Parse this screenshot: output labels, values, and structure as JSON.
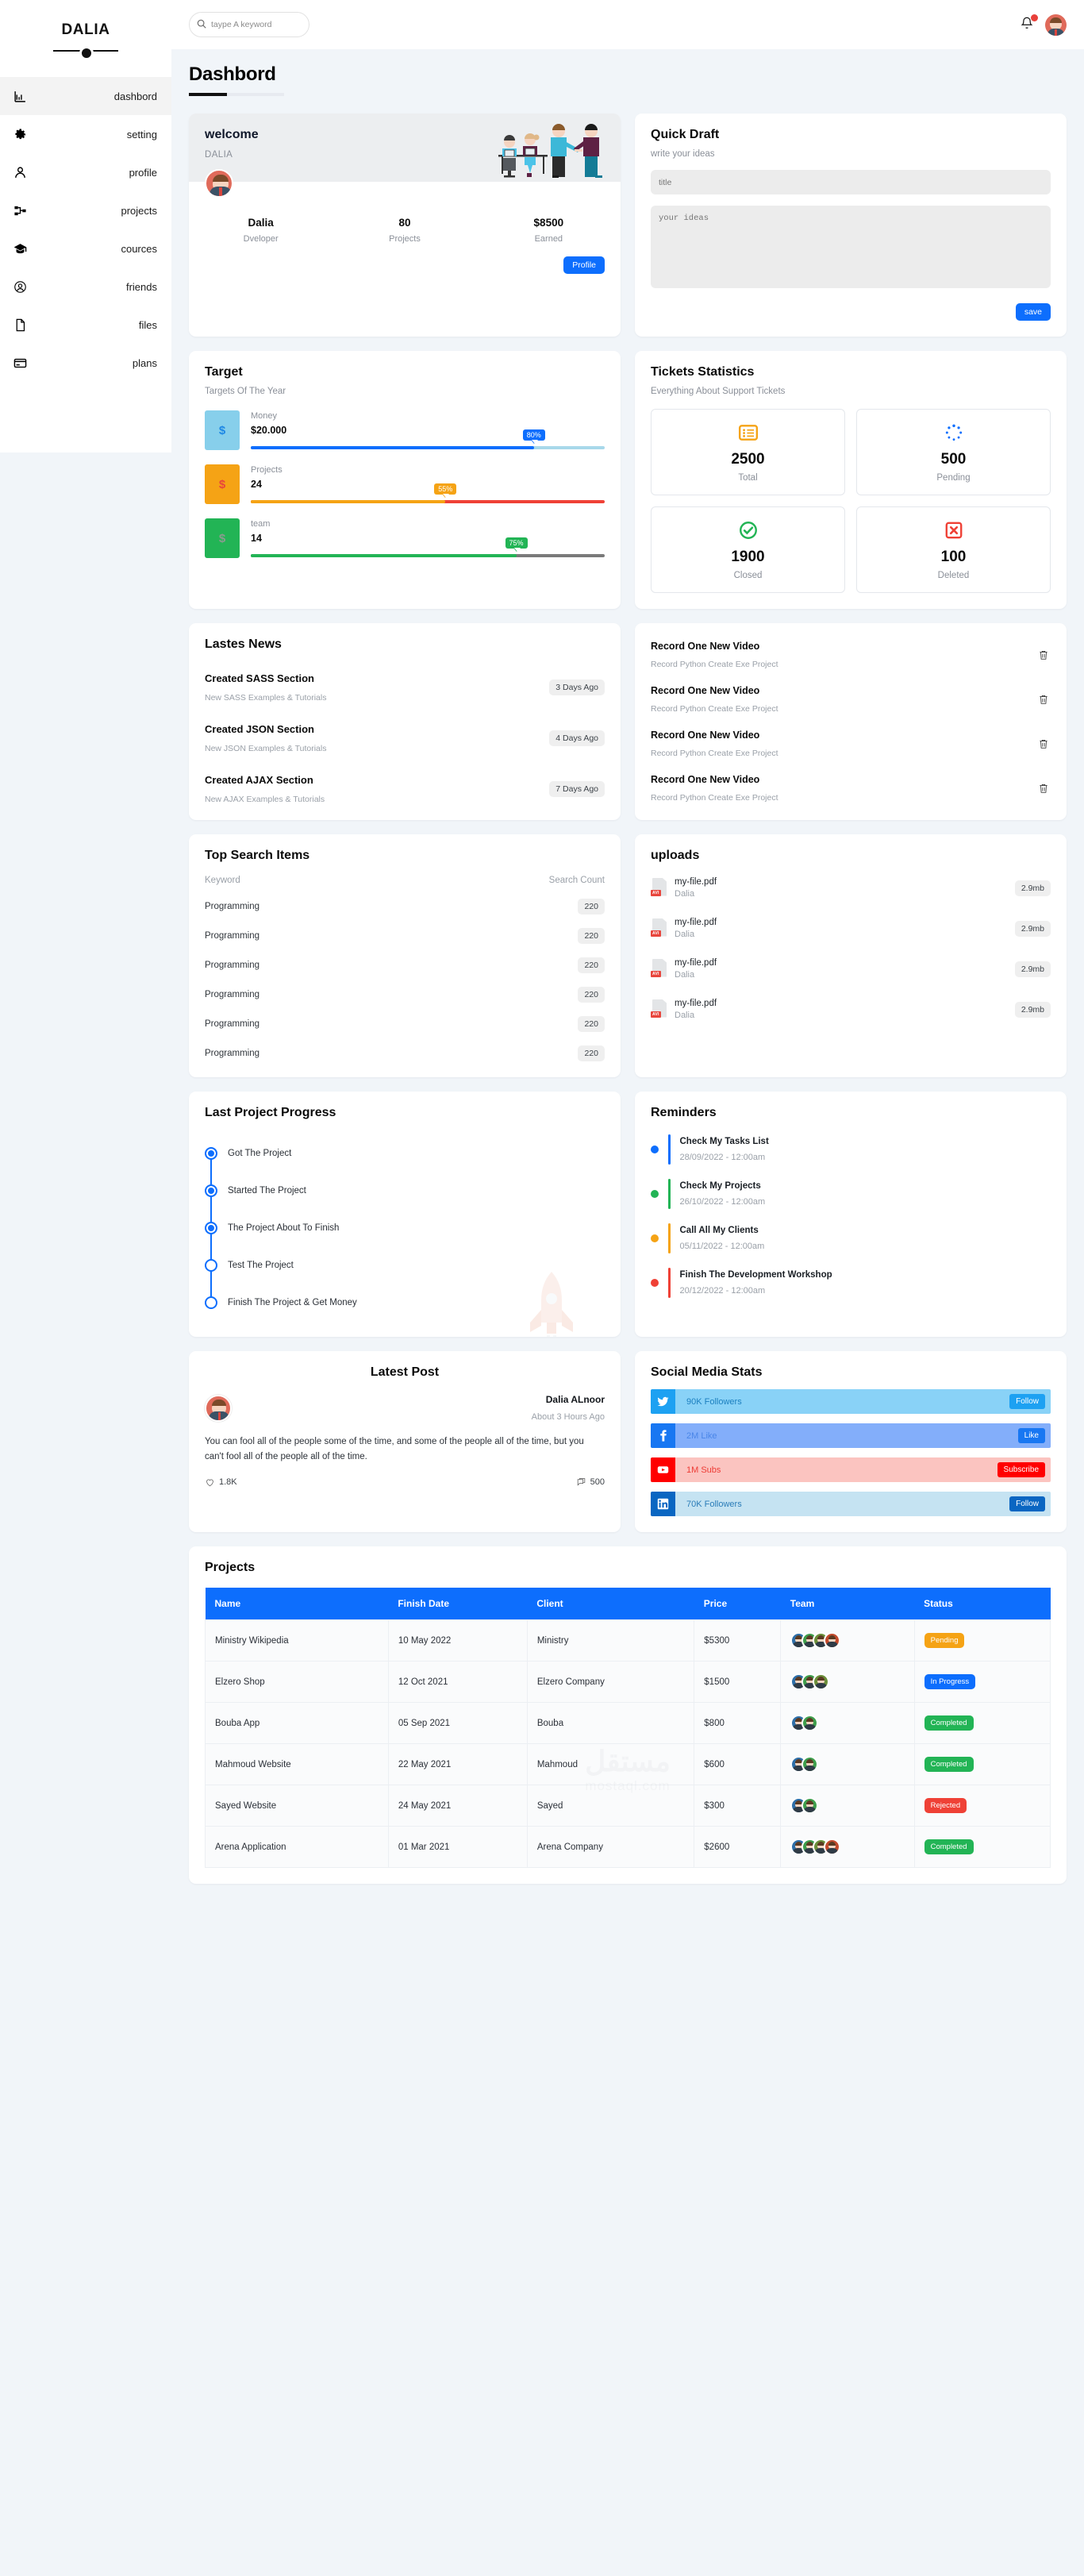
{
  "sidebar": {
    "brand": "DALIA",
    "items": [
      {
        "label": "dashbord",
        "icon": "chart-bar-icon",
        "active": true
      },
      {
        "label": "setting",
        "icon": "gear-icon",
        "active": false
      },
      {
        "label": "profile",
        "icon": "user-icon",
        "active": false
      },
      {
        "label": "projects",
        "icon": "sitemap-icon",
        "active": false
      },
      {
        "label": "cources",
        "icon": "graduation-cap-icon",
        "active": false
      },
      {
        "label": "friends",
        "icon": "user-circle-icon",
        "active": false
      },
      {
        "label": "files",
        "icon": "file-icon",
        "active": false
      },
      {
        "label": "plans",
        "icon": "credit-card-icon",
        "active": false
      }
    ]
  },
  "topbar": {
    "search_placeholder": "taype A keyword",
    "search_value": "",
    "notification_badge": true
  },
  "page": {
    "title": "Dashbord"
  },
  "welcome": {
    "heading": "welcome",
    "name": "DALIA",
    "stats": [
      {
        "value": "Dalia",
        "label": "Dveloper"
      },
      {
        "value": "80",
        "label": "Projects"
      },
      {
        "value": "$8500",
        "label": "Earned"
      }
    ],
    "button": "Profile"
  },
  "quick_draft": {
    "title": "Quick Draft",
    "subtitle": "write your ideas",
    "title_placeholder": "title",
    "title_value": "",
    "body_placeholder": "your ideas",
    "body_value": "",
    "save_label": "save"
  },
  "target": {
    "title": "Target",
    "subtitle": "Targets Of The Year",
    "rows": [
      {
        "label": "Money",
        "value": "$20.000",
        "percent": "80%",
        "pct": 80,
        "box_bg": "#87cfeb",
        "sym_color": "#1e88e5",
        "fill": "#0d6efd",
        "track": "#a8d8ea",
        "badge": "#0d6efd"
      },
      {
        "label": "Projects",
        "value": "24",
        "percent": "55%",
        "pct": 55,
        "box_bg": "#f5a315",
        "sym_color": "#e8453c",
        "fill": "#f5a315",
        "track": "#ef4136",
        "badge": "#f5a315"
      },
      {
        "label": "team",
        "value": "14",
        "percent": "75%",
        "pct": 75,
        "box_bg": "#22b455",
        "sym_color": "#8a9b8f",
        "fill": "#22b455",
        "track": "#7a7a7a",
        "badge": "#22b455"
      }
    ],
    "symbol": "$"
  },
  "tickets": {
    "title": "Tickets Statistics",
    "subtitle": "Everything About Support Tickets",
    "boxes": [
      {
        "number": "2500",
        "label": "Total",
        "icon": "list-icon",
        "color": "#f5a315"
      },
      {
        "number": "500",
        "label": "Pending",
        "icon": "spinner-icon",
        "color": "#0d6efd"
      },
      {
        "number": "1900",
        "label": "Closed",
        "icon": "check-circle-icon",
        "color": "#22b455"
      },
      {
        "number": "100",
        "label": "Deleted",
        "icon": "x-square-icon",
        "color": "#ef4136"
      }
    ]
  },
  "news": {
    "title": "Lastes News",
    "items": [
      {
        "title": "Created SASS Section",
        "sub": "New SASS Examples & Tutorials",
        "time": "3 Days Ago"
      },
      {
        "title": "Created JSON Section",
        "sub": "New JSON Examples & Tutorials",
        "time": "4 Days Ago"
      },
      {
        "title": "Created AJAX Section",
        "sub": "New AJAX Examples & Tutorials",
        "time": "7 Days Ago"
      }
    ]
  },
  "tasks": {
    "items": [
      {
        "title": "Record One New Video",
        "sub": "Record Python Create Exe Project"
      },
      {
        "title": "Record One New Video",
        "sub": "Record Python Create Exe Project"
      },
      {
        "title": "Record One New Video",
        "sub": "Record Python Create Exe Project"
      },
      {
        "title": "Record One New Video",
        "sub": "Record Python Create Exe Project"
      }
    ]
  },
  "search_items": {
    "title": "Top Search Items",
    "col_keyword": "Keyword",
    "col_count": "Search Count",
    "rows": [
      {
        "keyword": "Programming",
        "count": "220"
      },
      {
        "keyword": "Programming",
        "count": "220"
      },
      {
        "keyword": "Programming",
        "count": "220"
      },
      {
        "keyword": "Programming",
        "count": "220"
      },
      {
        "keyword": "Programming",
        "count": "220"
      },
      {
        "keyword": "Programming",
        "count": "220"
      }
    ]
  },
  "uploads": {
    "title": "uploads",
    "rows": [
      {
        "name": "my-file.pdf",
        "user": "Dalia",
        "size": "2.9mb",
        "tag": "AVI"
      },
      {
        "name": "my-file.pdf",
        "user": "Dalia",
        "size": "2.9mb",
        "tag": "AVI"
      },
      {
        "name": "my-file.pdf",
        "user": "Dalia",
        "size": "2.9mb",
        "tag": "AVI"
      },
      {
        "name": "my-file.pdf",
        "user": "Dalia",
        "size": "2.9mb",
        "tag": "AVI"
      }
    ]
  },
  "progress": {
    "title": "Last Project Progress",
    "steps": [
      {
        "label": "Got The Project",
        "done": true
      },
      {
        "label": "Started The Project",
        "done": true
      },
      {
        "label": "The Project About To Finish",
        "done": true
      },
      {
        "label": "Test The Project",
        "done": false
      },
      {
        "label": "Finish The Project & Get Money",
        "done": false
      }
    ]
  },
  "reminders": {
    "title": "Reminders",
    "items": [
      {
        "title": "Check My Tasks List",
        "date": "28/09/2022 - 12:00am",
        "color": "#0d6efd"
      },
      {
        "title": "Check My Projects",
        "date": "26/10/2022 - 12:00am",
        "color": "#22b455"
      },
      {
        "title": "Call All My Clients",
        "date": "05/11/2022 - 12:00am",
        "color": "#f5a315"
      },
      {
        "title": "Finish The Development Workshop",
        "date": "20/12/2022 - 12:00am",
        "color": "#ef4136"
      }
    ]
  },
  "latest_post": {
    "title": "Latest Post",
    "author": "Dalia ALnoor",
    "time": "About 3 Hours Ago",
    "body": "You can fool all of the people some of the time, and some of the people all of the time, but you can't fool all of the people all of the time.",
    "likes": "1.8K",
    "comments": "500"
  },
  "social": {
    "title": "Social Media Stats",
    "rows": [
      {
        "network": "twitter",
        "icon": "twitter-icon",
        "count": "90K Followers",
        "button": "Follow",
        "icon_bg": "#1da1f2",
        "row_bg": "#89d2f7",
        "text": "#1b7fbf",
        "btn_bg": "#1da1f2"
      },
      {
        "network": "facebook",
        "icon": "facebook-icon",
        "count": "2M Like",
        "button": "Like",
        "icon_bg": "#1877f2",
        "row_bg": "#83aefa",
        "text": "#4a86e8",
        "btn_bg": "#1877f2"
      },
      {
        "network": "youtube",
        "icon": "youtube-icon",
        "count": "1M Subs",
        "button": "Subscribe",
        "icon_bg": "#ff0000",
        "row_bg": "#fbc4c0",
        "text": "#ed3b34",
        "btn_bg": "#ff0000"
      },
      {
        "network": "linkedin",
        "icon": "linkedin-icon",
        "count": "70K Followers",
        "button": "Follow",
        "icon_bg": "#0a66c2",
        "row_bg": "#c5e3f2",
        "text": "#2a7cb8",
        "btn_bg": "#0a66c2"
      }
    ]
  },
  "projects": {
    "title": "Projects",
    "columns": [
      "Name",
      "Finish Date",
      "Client",
      "Price",
      "Team",
      "Status"
    ],
    "rows": [
      {
        "name": "Ministry Wikipedia",
        "date": "10 May 2022",
        "client": "Ministry",
        "price": "$5300",
        "team": 4,
        "status": "Pending",
        "status_color": "#f5a315"
      },
      {
        "name": "Elzero Shop",
        "date": "12 Oct 2021",
        "client": "Elzero Company",
        "price": "$1500",
        "team": 3,
        "status": "In Progress",
        "status_color": "#0d6efd"
      },
      {
        "name": "Bouba App",
        "date": "05 Sep 2021",
        "client": "Bouba",
        "price": "$800",
        "team": 2,
        "status": "Completed",
        "status_color": "#22b455"
      },
      {
        "name": "Mahmoud Website",
        "date": "22 May 2021",
        "client": "Mahmoud",
        "price": "$600",
        "team": 2,
        "status": "Completed",
        "status_color": "#22b455"
      },
      {
        "name": "Sayed Website",
        "date": "24 May 2021",
        "client": "Sayed",
        "price": "$300",
        "team": 2,
        "status": "Rejected",
        "status_color": "#ef4136"
      },
      {
        "name": "Arena Application",
        "date": "01 Mar 2021",
        "client": "Arena Company",
        "price": "$2600",
        "team": 4,
        "status": "Completed",
        "status_color": "#22b455"
      }
    ]
  },
  "watermark": {
    "arabic": "مستقل",
    "latin": "mostaql.com"
  }
}
